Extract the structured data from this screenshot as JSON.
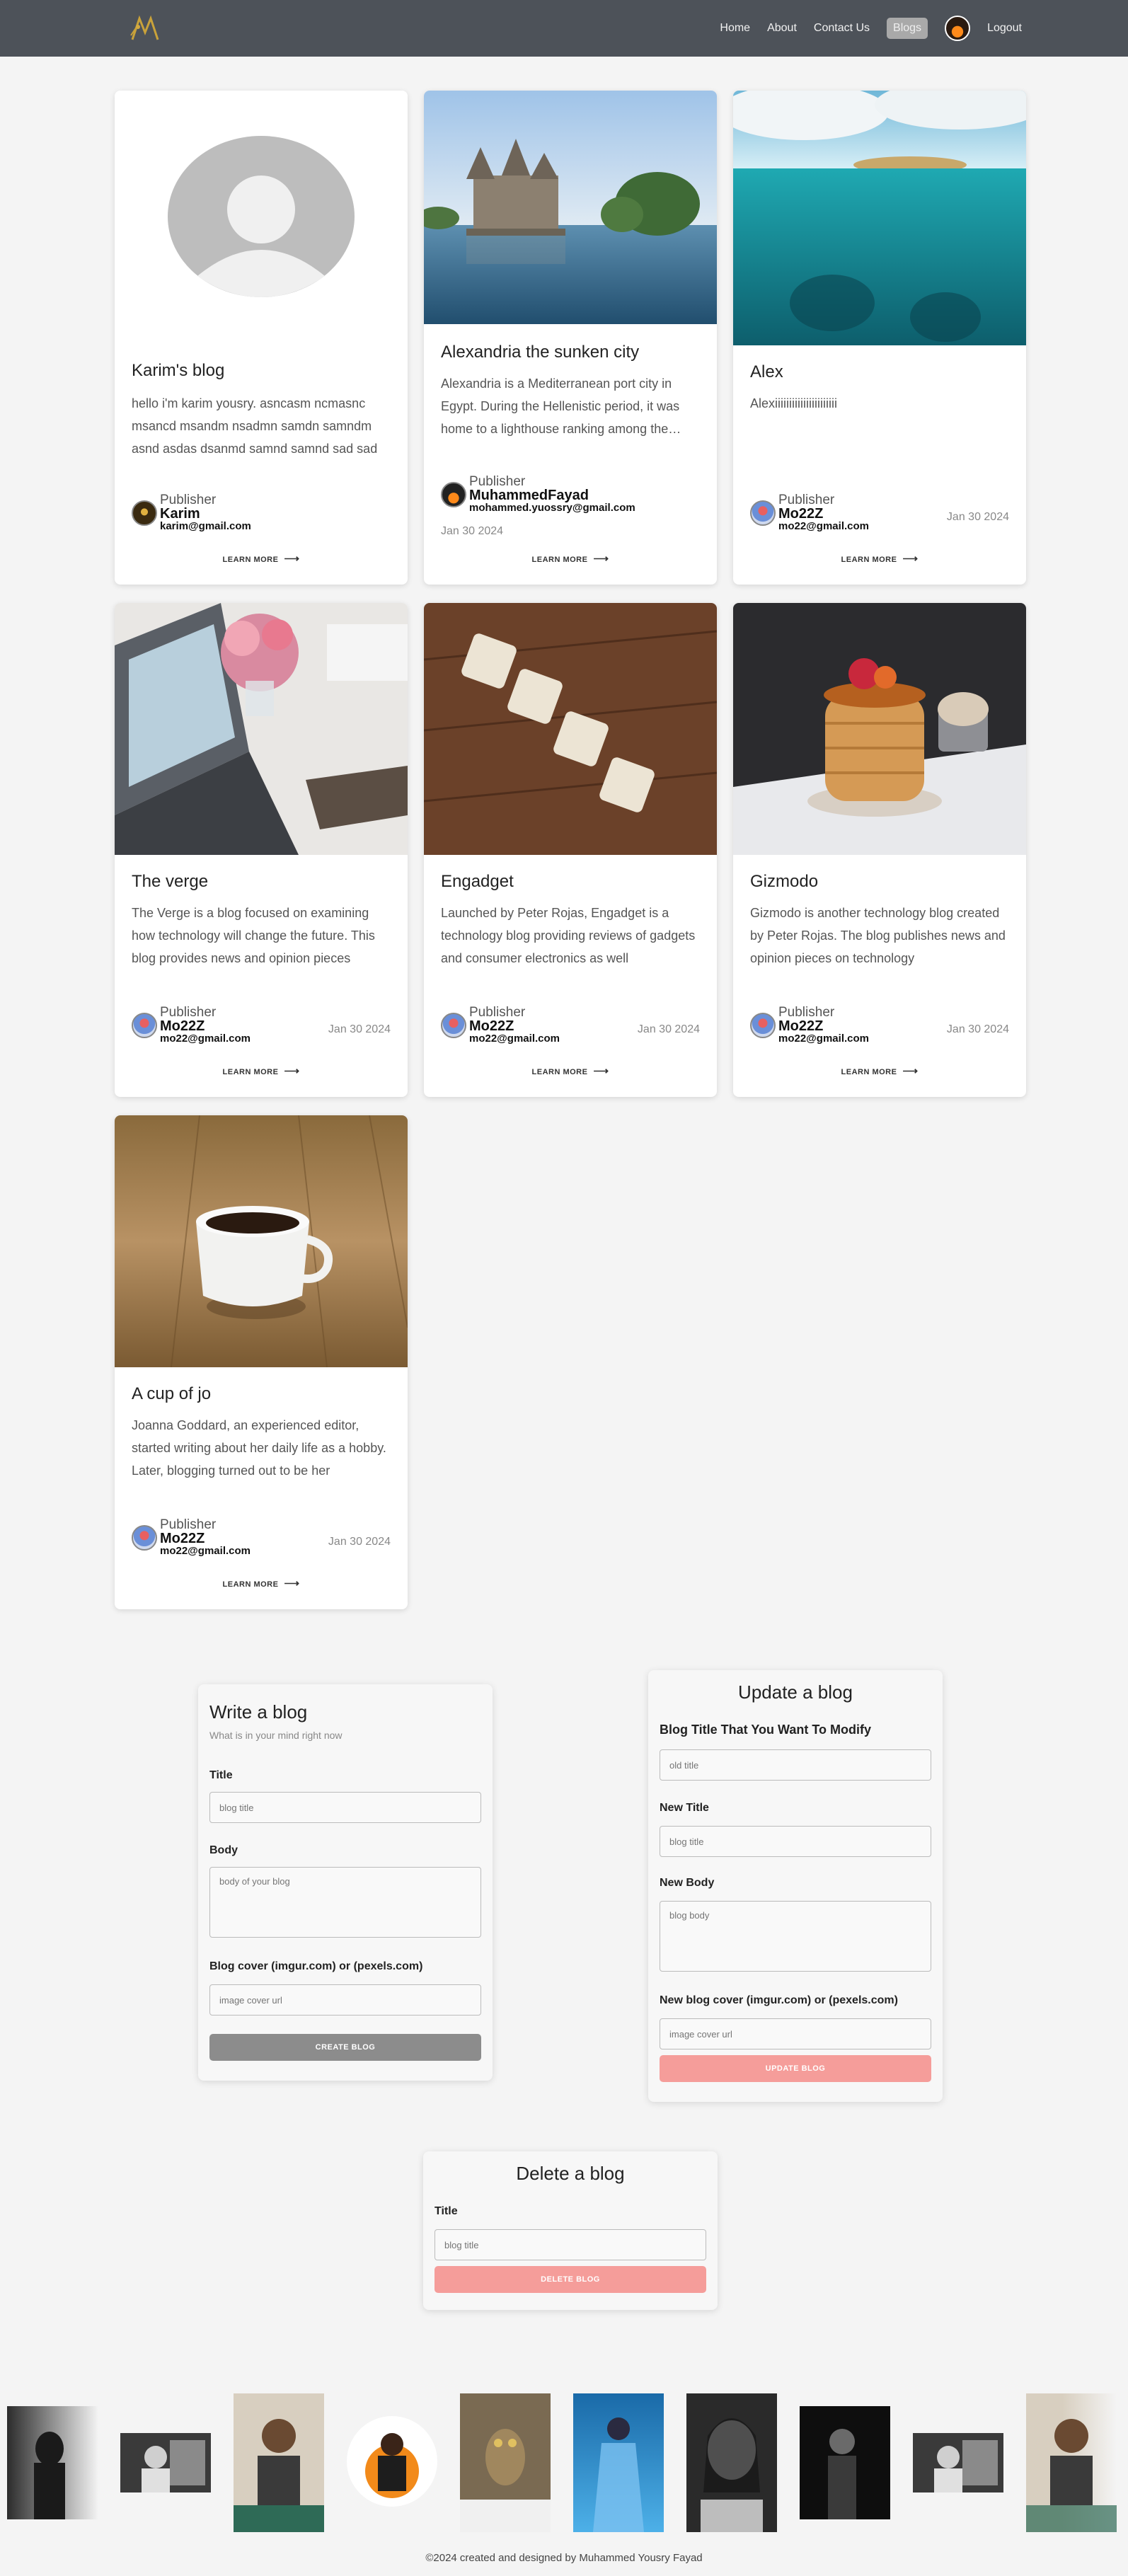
{
  "nav": {
    "links": [
      "Home",
      "About",
      "Contact Us",
      "Blogs"
    ],
    "logout": "Logout"
  },
  "posts": [
    {
      "title": "Karim's blog",
      "body": "hello i'm karim yousry. asncasm ncmasnc msancd msandm nsadmn samdn samndm asnd asdas dsanmd samnd samnd sad sad",
      "publisher_label": "Publisher",
      "publisher": "Karim",
      "email": "karim@gmail.com",
      "date": "",
      "image": "default-avatar"
    },
    {
      "title": "Alexandria the sunken city",
      "body": "Alexandria is a Mediterranean port city in Egypt. During the Hellenistic period, it was home to a lighthouse ranking among the Seven Wonders",
      "publisher_label": "Publisher",
      "publisher": "MuhammedFayad",
      "email": "mohammed.yuossry@gmail.com",
      "date": "Jan 30 2024",
      "image": "castle-lake"
    },
    {
      "title": "Alex",
      "body": "Alexiiiiiiiiiiiiiiiiiiiiii",
      "publisher_label": "Publisher",
      "publisher": "Mo22Z",
      "email": "mo22@gmail.com",
      "date": "Jan 30 2024",
      "image": "island-underwater"
    },
    {
      "title": "The verge",
      "body": "The Verge is a blog focused on examining how technology will change the future. This blog provides news and opinion pieces",
      "publisher_label": "Publisher",
      "publisher": "Mo22Z",
      "email": "mo22@gmail.com",
      "date": "Jan 30 2024",
      "image": "laptop-flowers"
    },
    {
      "title": "Engadget",
      "body": "Launched by Peter Rojas, Engadget is a technology blog providing reviews of gadgets and consumer electronics as well",
      "publisher_label": "Publisher",
      "publisher": "Mo22Z",
      "email": "mo22@gmail.com",
      "date": "Jan 30 2024",
      "image": "blog-tiles"
    },
    {
      "title": "Gizmodo",
      "body": "Gizmodo is another technology blog created by Peter Rojas. The blog publishes news and opinion pieces on technology",
      "publisher_label": "Publisher",
      "publisher": "Mo22Z",
      "email": "mo22@gmail.com",
      "date": "Jan 30 2024",
      "image": "pancakes"
    },
    {
      "title": "A cup of jo",
      "body": "Joanna Goddard, an experienced editor, started writing about her daily life as a hobby. Later, blogging turned out to be her",
      "publisher_label": "Publisher",
      "publisher": "Mo22Z",
      "email": "mo22@gmail.com",
      "date": "Jan 30 2024",
      "image": "coffee-cup"
    }
  ],
  "learn_more": "LEARN MORE",
  "create_form": {
    "heading": "Write a blog",
    "subheading": "What is in your mind right now",
    "title_label": "Title",
    "title_placeholder": "blog title",
    "body_label": "Body",
    "body_placeholder": "body of your blog",
    "cover_label": "Blog cover (imgur.com) or (pexels.com)",
    "cover_placeholder": "image cover url",
    "submit": "CREATE BLOG"
  },
  "update_form": {
    "heading": "Update a blog",
    "old_label": "Blog Title That You Want To Modify",
    "old_placeholder": "old title",
    "new_title_label": "New Title",
    "new_title_placeholder": "blog title",
    "new_body_label": "New Body",
    "new_body_placeholder": "blog body",
    "cover_label": "New blog cover (imgur.com) or (pexels.com)",
    "cover_placeholder": "image cover url",
    "submit": "UPDATE BLOG"
  },
  "delete_form": {
    "heading": "Delete a blog",
    "title_label": "Title",
    "title_placeholder": "blog title",
    "submit": "DELETE BLOG"
  },
  "footer": "©2024 created and designed by Muhammed Yousry Fayad",
  "colors": {
    "nav": "#4d5259",
    "create_button": "#8c8c8c",
    "danger_button": "#f59d9a"
  }
}
